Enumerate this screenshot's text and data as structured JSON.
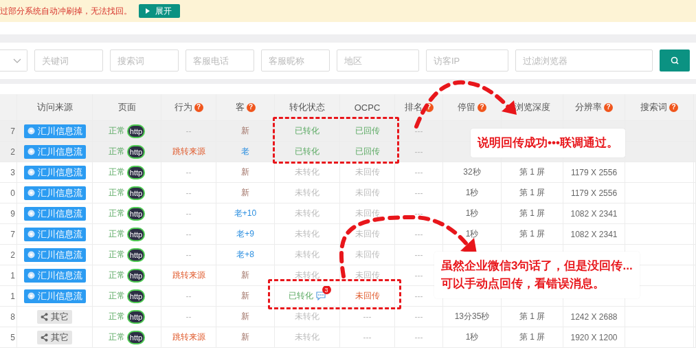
{
  "banner": {
    "message": "过部分系统自动冲刷掉，无法找回。",
    "button": "展开"
  },
  "filters": {
    "fields": [
      {
        "kind": "select"
      },
      {
        "kind": "text",
        "placeholder": "关键词"
      },
      {
        "kind": "text",
        "placeholder": "搜索词"
      },
      {
        "kind": "text",
        "placeholder": "客服电话"
      },
      {
        "kind": "text",
        "placeholder": "客服昵称"
      },
      {
        "kind": "text",
        "placeholder": "地区"
      },
      {
        "kind": "text",
        "placeholder": "访客IP"
      },
      {
        "kind": "text",
        "placeholder": "过滤浏览器"
      },
      {
        "kind": "search"
      }
    ]
  },
  "table": {
    "columns": [
      {
        "kind": "blank"
      },
      {
        "kind": "text",
        "label": "访问来源"
      },
      {
        "kind": "text",
        "label": "页面"
      },
      {
        "kind": "text",
        "label": "行为",
        "help": "?"
      },
      {
        "kind": "text",
        "label": "客",
        "help": "?"
      },
      {
        "kind": "text",
        "label": "转化状态"
      },
      {
        "kind": "text",
        "label": "OCPC"
      },
      {
        "kind": "text",
        "label": "排名",
        "help": "?"
      },
      {
        "kind": "text",
        "label": "停留",
        "help": "?"
      },
      {
        "kind": "text",
        "label": "浏览深度"
      },
      {
        "kind": "text",
        "label": "分辨率",
        "help": "?"
      },
      {
        "kind": "text",
        "label": "搜索词",
        "help": "?"
      }
    ],
    "rows": [
      {
        "number": "7",
        "highlighted": true,
        "source": {
          "kind": "feed",
          "label": "汇川信息流"
        },
        "page": {
          "status": "正常",
          "badge": "http"
        },
        "action": {
          "kind": "none",
          "text": "--"
        },
        "visitor": {
          "kind": "new",
          "text": "新"
        },
        "conversion": {
          "converted": true,
          "text": "已转化"
        },
        "ocpc": {
          "kind": "sent",
          "text": "已回传"
        },
        "rank": "---"
      },
      {
        "number": "2",
        "highlighted": true,
        "source": {
          "kind": "feed",
          "label": "汇川信息流"
        },
        "page": {
          "status": "正常",
          "badge": "http"
        },
        "action": {
          "kind": "redirect",
          "text": "跳转来源"
        },
        "visitor": {
          "kind": "returning",
          "text": "老"
        },
        "conversion": {
          "converted": true,
          "text": "已转化"
        },
        "ocpc": {
          "kind": "sent",
          "text": "已回传"
        },
        "rank": "---"
      },
      {
        "number": "3",
        "highlighted": false,
        "source": {
          "kind": "feed",
          "label": "汇川信息流"
        },
        "page": {
          "status": "正常",
          "badge": "http"
        },
        "action": {
          "kind": "none",
          "text": "--"
        },
        "visitor": {
          "kind": "new",
          "text": "新"
        },
        "conversion": {
          "converted": false,
          "text": "未转化"
        },
        "ocpc": {
          "kind": "unsent",
          "text": "未回传"
        },
        "rank": "---",
        "stay": "32秒",
        "depth": "第 1 屏",
        "resolution": "1179 X 2556"
      },
      {
        "number": "0",
        "highlighted": false,
        "source": {
          "kind": "feed",
          "label": "汇川信息流"
        },
        "page": {
          "status": "正常",
          "badge": "http"
        },
        "action": {
          "kind": "none",
          "text": "--"
        },
        "visitor": {
          "kind": "new",
          "text": "新"
        },
        "conversion": {
          "converted": false,
          "text": "未转化"
        },
        "ocpc": {
          "kind": "unsent",
          "text": "未回传"
        },
        "rank": "---",
        "stay": "1秒",
        "depth": "第 1 屏",
        "resolution": "1179 X 2556"
      },
      {
        "number": "9",
        "highlighted": false,
        "source": {
          "kind": "feed",
          "label": "汇川信息流"
        },
        "page": {
          "status": "正常",
          "badge": "http"
        },
        "action": {
          "kind": "none",
          "text": "--"
        },
        "visitor": {
          "kind": "returning",
          "text": "老+10"
        },
        "conversion": {
          "converted": false,
          "text": "未转化"
        },
        "ocpc": {
          "kind": "unsent",
          "text": "未回传"
        },
        "rank": "---",
        "stay": "1秒",
        "depth": "第 1 屏",
        "resolution": "1082 X 2341"
      },
      {
        "number": "7",
        "highlighted": false,
        "source": {
          "kind": "feed",
          "label": "汇川信息流"
        },
        "page": {
          "status": "正常",
          "badge": "http"
        },
        "action": {
          "kind": "none",
          "text": "--"
        },
        "visitor": {
          "kind": "returning",
          "text": "老+9"
        },
        "conversion": {
          "converted": false,
          "text": "未转化"
        },
        "ocpc": {
          "kind": "unsent",
          "text": "未回传"
        },
        "rank": "---",
        "stay": "1秒",
        "depth": "第 1 屏",
        "resolution": "1082 X 2341"
      },
      {
        "number": "2",
        "highlighted": false,
        "source": {
          "kind": "feed",
          "label": "汇川信息流"
        },
        "page": {
          "status": "正常",
          "badge": "http"
        },
        "action": {
          "kind": "none",
          "text": "--"
        },
        "visitor": {
          "kind": "returning",
          "text": "老+8"
        },
        "conversion": {
          "converted": false,
          "text": "未转化"
        },
        "ocpc": {
          "kind": "unsent",
          "text": "未回传"
        },
        "rank": "---"
      },
      {
        "number": "1",
        "highlighted": false,
        "source": {
          "kind": "feed",
          "label": "汇川信息流"
        },
        "page": {
          "status": "正常",
          "badge": "http"
        },
        "action": {
          "kind": "redirect",
          "text": "跳转来源"
        },
        "visitor": {
          "kind": "new",
          "text": "新"
        },
        "conversion": {
          "converted": false,
          "text": "未转化"
        },
        "ocpc": {
          "kind": "unsent",
          "text": "未回传"
        },
        "rank": "---"
      },
      {
        "number": "1",
        "highlighted": false,
        "source": {
          "kind": "feed",
          "label": "汇川信息流"
        },
        "page": {
          "status": "正常",
          "badge": "http"
        },
        "action": {
          "kind": "none",
          "text": "--"
        },
        "visitor": {
          "kind": "new",
          "text": "新"
        },
        "conversion": {
          "converted": true,
          "text": "已转化",
          "chat_count": "3"
        },
        "ocpc": {
          "kind": "failed",
          "text": "未回传"
        },
        "rank": "---"
      },
      {
        "number": "8",
        "highlighted": false,
        "source": {
          "kind": "other",
          "label": "其它"
        },
        "page": {
          "status": "正常",
          "badge": "http"
        },
        "action": {
          "kind": "none",
          "text": "--"
        },
        "visitor": {
          "kind": "new",
          "text": "新"
        },
        "conversion": {
          "converted": false,
          "text": "未转化"
        },
        "ocpc": {
          "kind": "none",
          "text": "---"
        },
        "rank": "---",
        "stay": "13分35秒",
        "depth": "第 1 屏",
        "resolution": "1242 X 2688"
      },
      {
        "number": "5",
        "highlighted": false,
        "source": {
          "kind": "other",
          "label": "其它"
        },
        "page": {
          "status": "正常",
          "badge": "http"
        },
        "action": {
          "kind": "redirect",
          "text": "跳转来源"
        },
        "visitor": {
          "kind": "new",
          "text": "新"
        },
        "conversion": {
          "converted": false,
          "text": "未转化"
        },
        "ocpc": {
          "kind": "none",
          "text": "---"
        },
        "rank": "---",
        "stay": "1秒",
        "depth": "第 1 屏",
        "resolution": "1920 X 1200"
      }
    ]
  },
  "annotations": {
    "callouts": [
      {
        "lines": [
          "说明回传成功•••联调通过。"
        ]
      },
      {
        "lines": [
          "虽然企业微信3句话了，但是没回传...",
          "可以手动点回传，看错误消息。"
        ]
      }
    ]
  }
}
